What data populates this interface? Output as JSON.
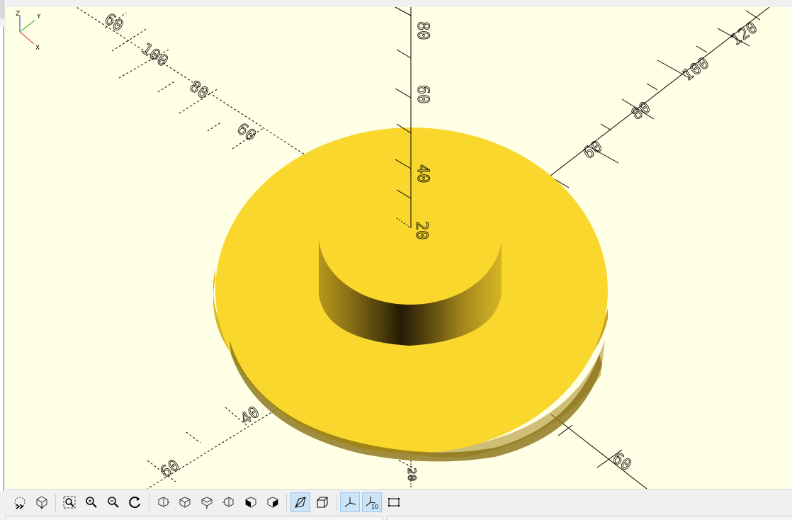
{
  "axes": {
    "x_pos_labels": [
      "60",
      "80",
      "100",
      "120"
    ],
    "x_neg_labels": [
      "40",
      "60"
    ],
    "y_pos_labels": [
      "60",
      "80",
      "100",
      "120"
    ],
    "y_neg_labels": [
      "40",
      "60"
    ],
    "z_labels": [
      "20",
      "40",
      "60",
      "80"
    ],
    "bottom_label": "20"
  },
  "mini_axes": {
    "x": "X",
    "y": "Y",
    "z": "Z"
  },
  "colors": {
    "background": "#ffffe5",
    "part_top": "#f9d72c",
    "part_side_dark": "#3a300a",
    "part_side_mid": "#c9a722"
  },
  "toolbar": {
    "buttons": [
      {
        "icon": "preview-icon",
        "active": false
      },
      {
        "icon": "render-icon",
        "active": false
      },
      {
        "icon": "view-all-icon",
        "active": false
      },
      {
        "icon": "zoom-in-icon",
        "active": false
      },
      {
        "icon": "zoom-out-icon",
        "active": false
      },
      {
        "icon": "reset-view-icon",
        "active": false
      },
      {
        "icon": "view-right-icon",
        "active": false
      },
      {
        "icon": "view-top-icon",
        "active": false
      },
      {
        "icon": "view-bottom-icon",
        "active": false
      },
      {
        "icon": "view-left-icon",
        "active": false
      },
      {
        "icon": "view-front-icon",
        "active": false
      },
      {
        "icon": "view-back-icon",
        "active": false
      },
      {
        "icon": "perspective-icon",
        "active": true
      },
      {
        "icon": "orthogonal-icon",
        "active": false
      },
      {
        "icon": "show-axes-icon",
        "active": true
      },
      {
        "icon": "show-scale-markers-icon",
        "active": true
      },
      {
        "icon": "show-edges-icon",
        "active": false
      }
    ],
    "scale_marker_label": "10"
  }
}
